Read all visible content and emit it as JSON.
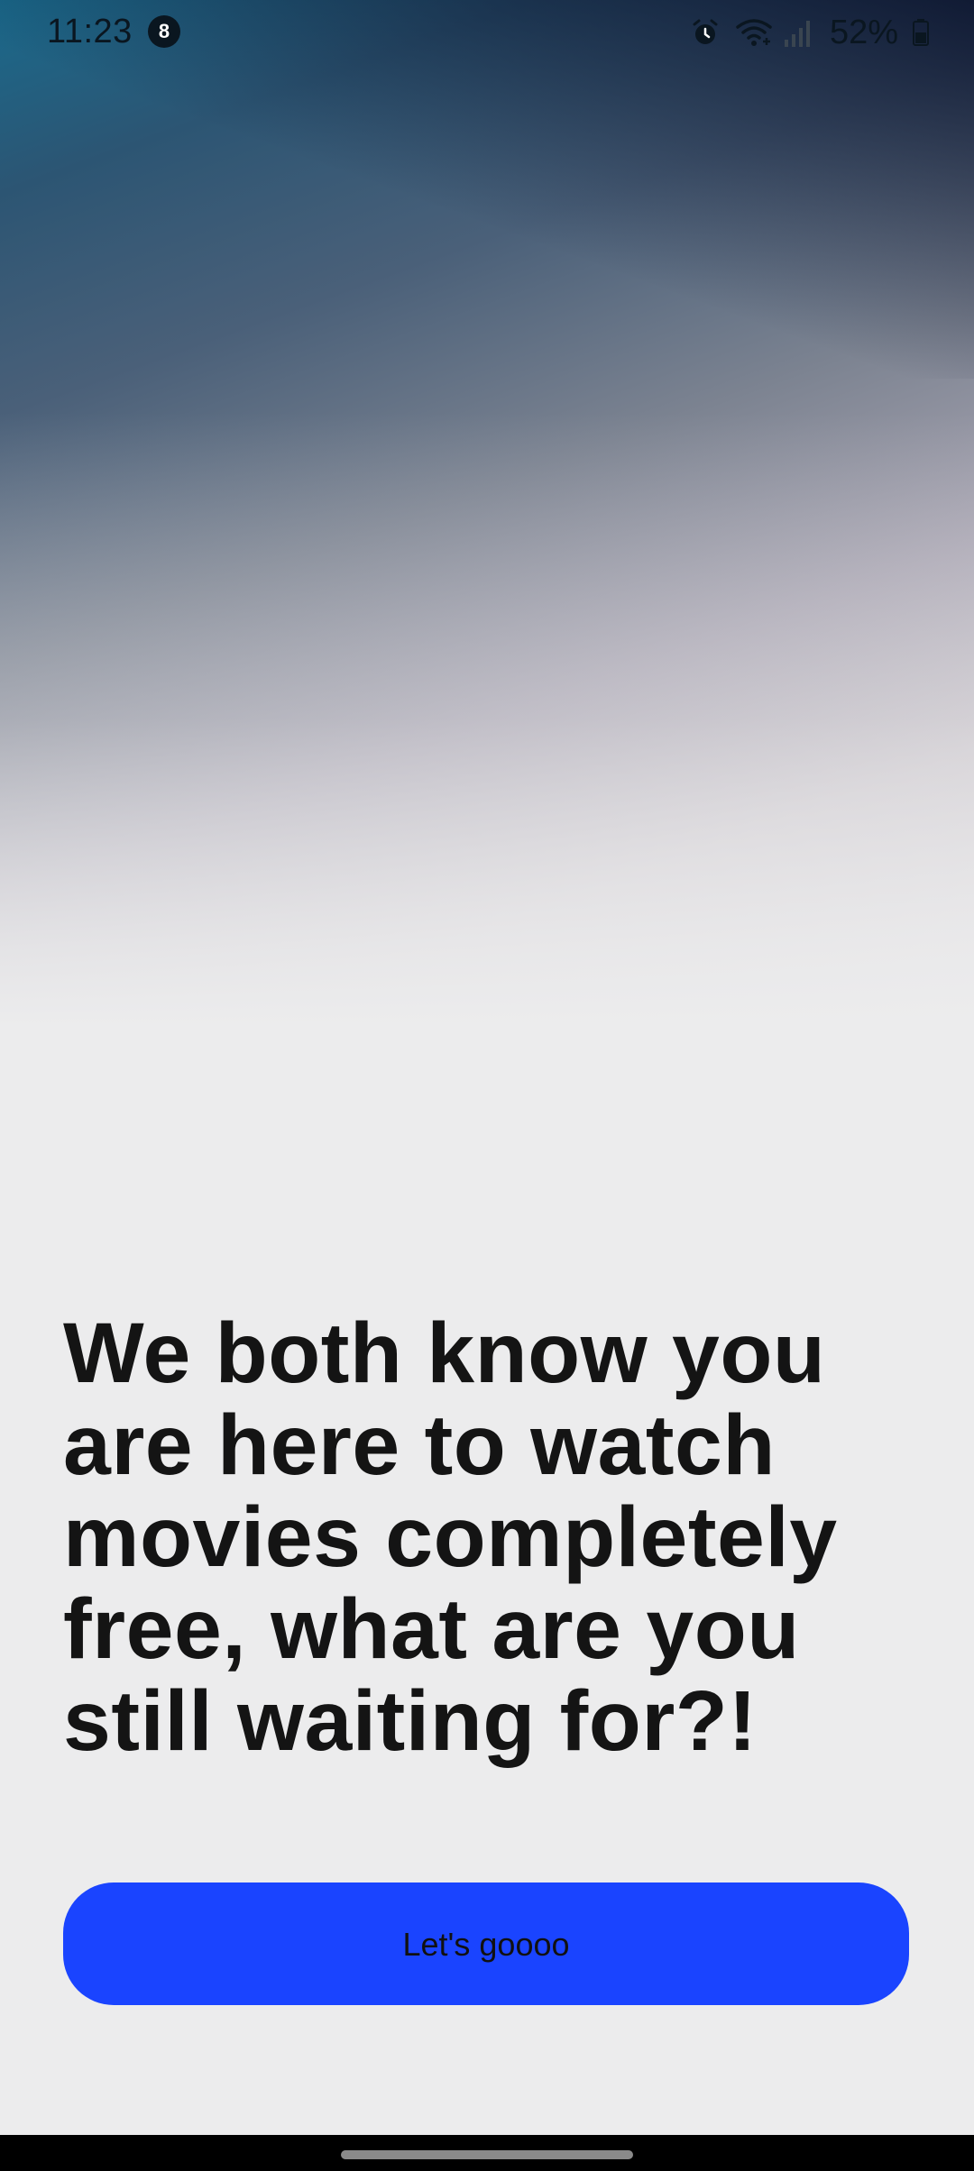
{
  "status_bar": {
    "time": "11:23",
    "notification_count": "8",
    "battery_percent": "52%",
    "icons": [
      "alarm-icon",
      "wifi-icon",
      "cellular-signal-icon",
      "battery-icon"
    ]
  },
  "onboarding": {
    "headline": "We both know you are here to watch movies completely free, what are you still waiting for?!",
    "cta_label": "Let's goooo"
  },
  "colors": {
    "accent": "#1a44ff",
    "background": "#ececed",
    "text": "#141414"
  }
}
